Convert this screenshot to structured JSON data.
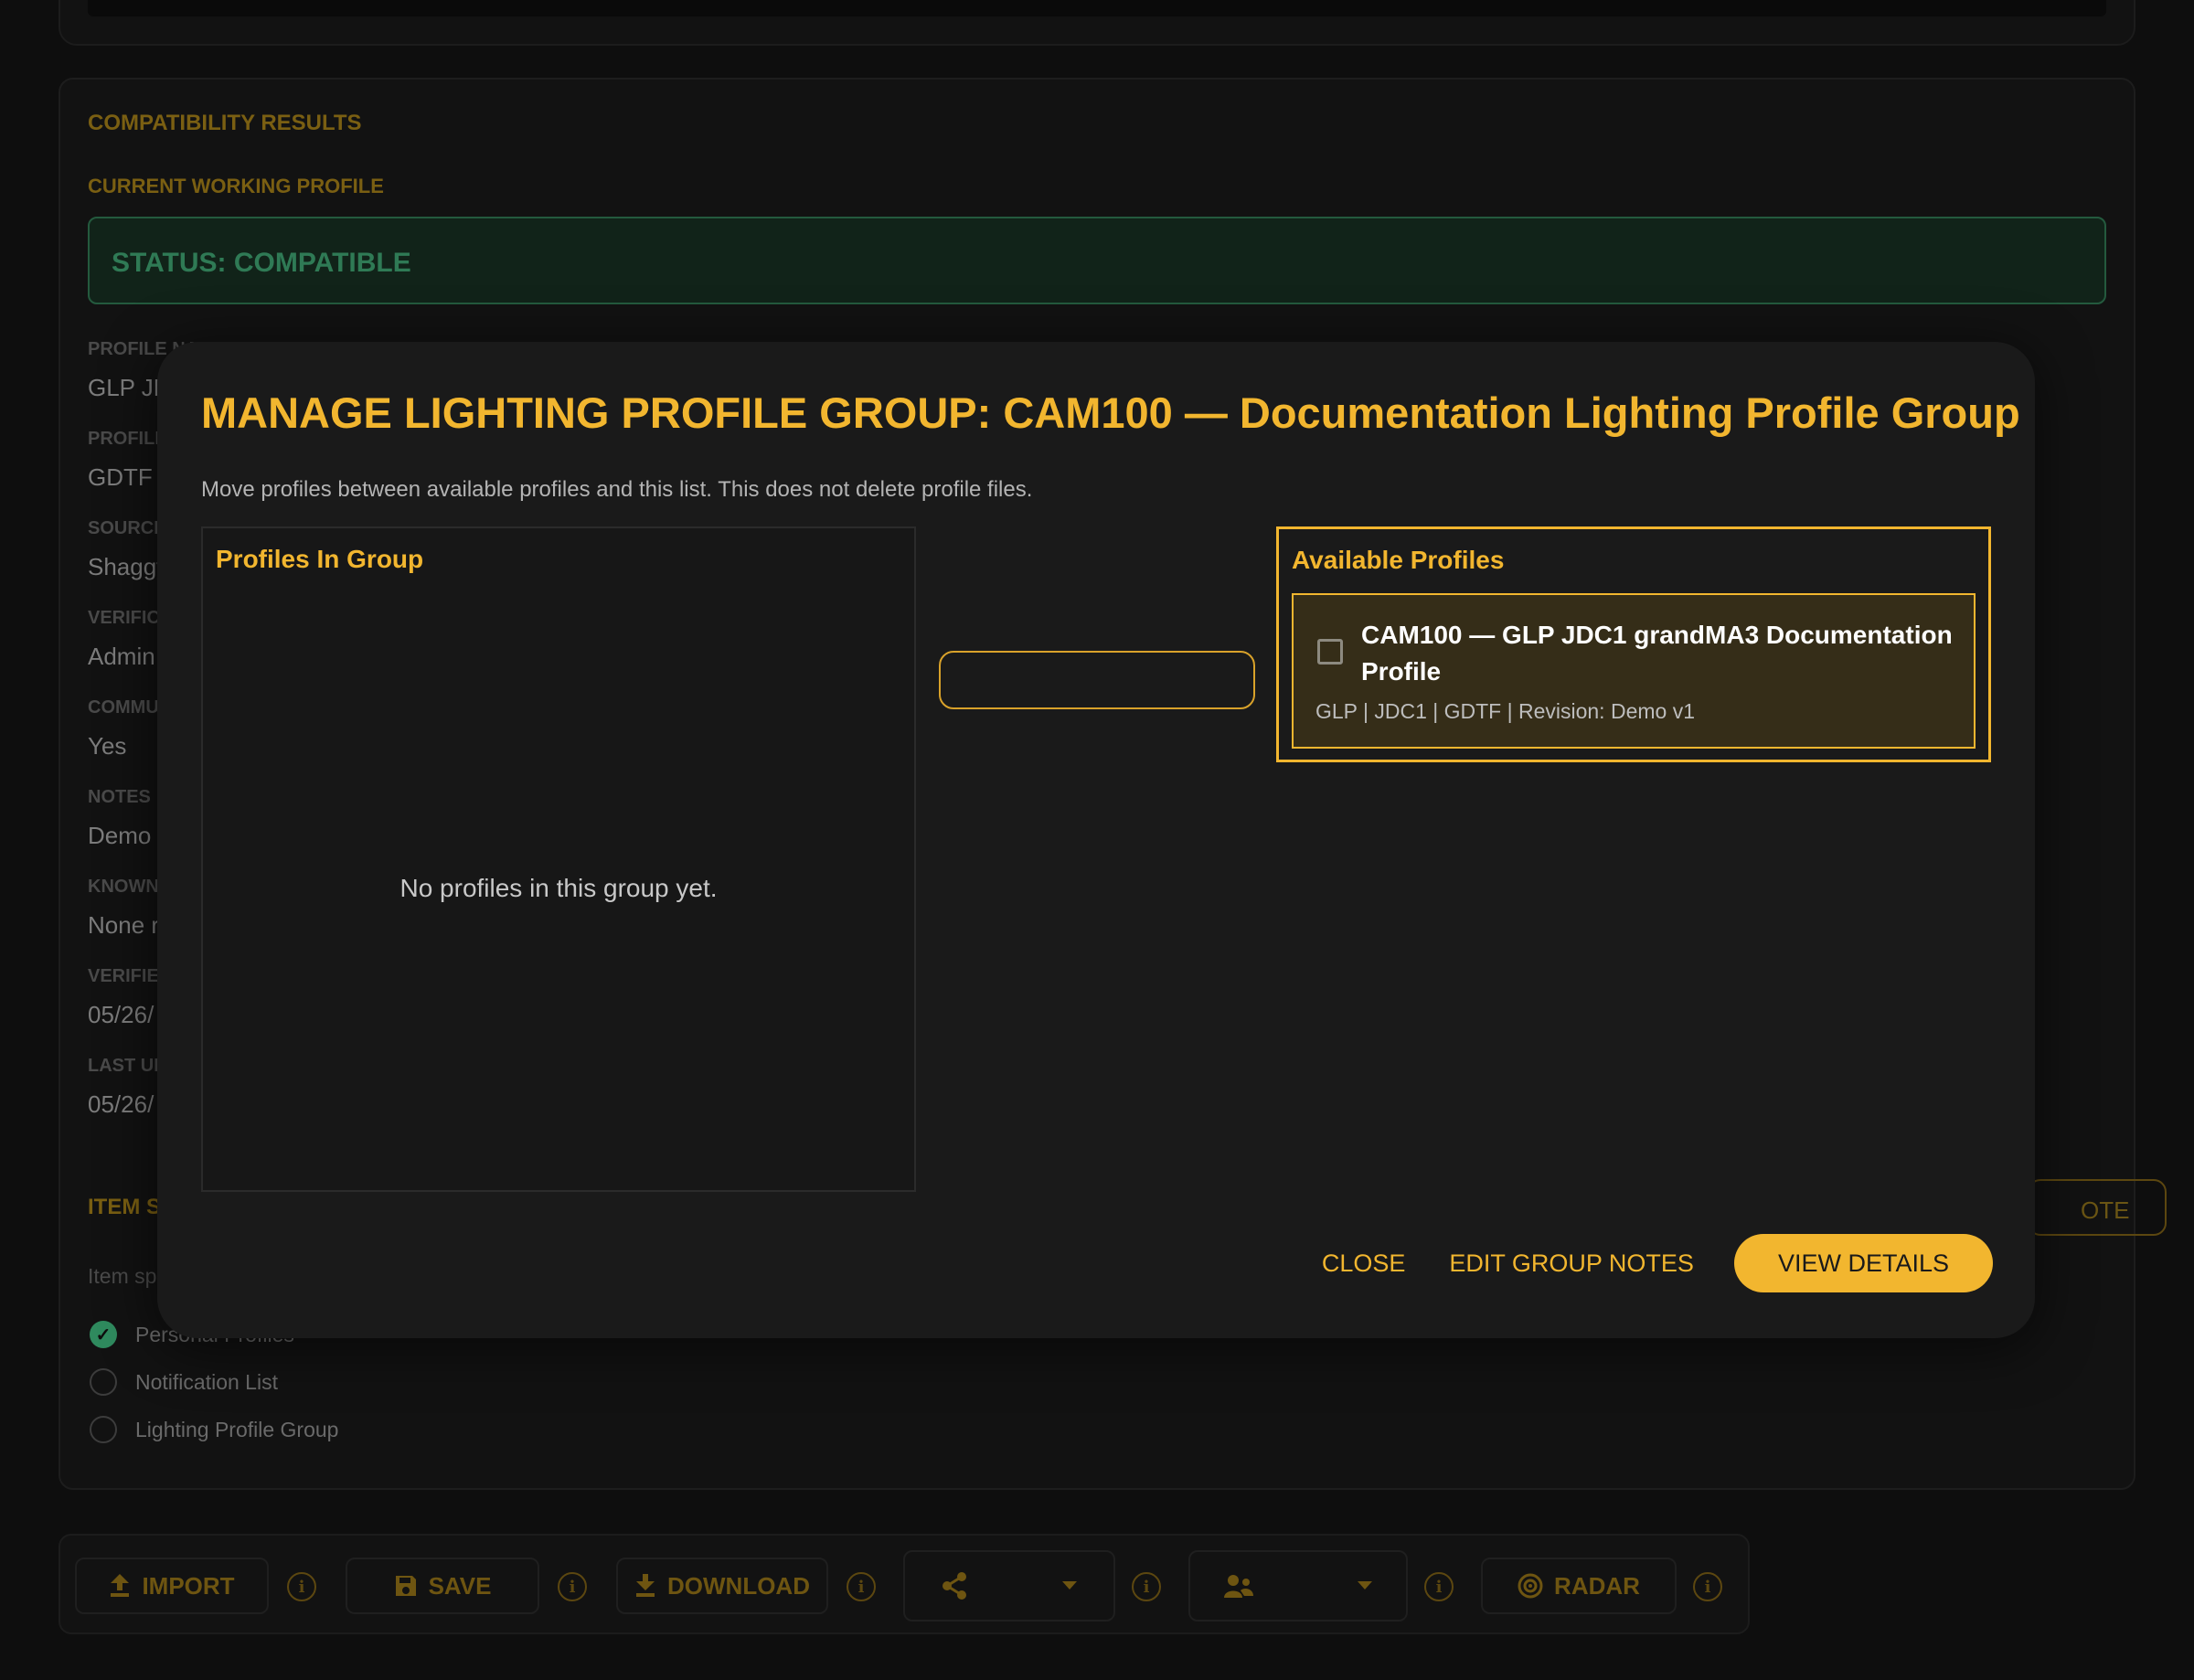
{
  "background": {
    "results_title": "COMPATIBILITY RESULTS",
    "current_profile_label": "CURRENT WORKING PROFILE",
    "status_text": "STATUS: COMPATIBLE",
    "fields": [
      {
        "label": "PROFILE NAME",
        "value": "GLP JD"
      },
      {
        "label": "PROFILE",
        "value": "GDTF"
      },
      {
        "label": "SOURCE",
        "value": "Shaggy"
      },
      {
        "label": "VERIFIC",
        "value": "Admin"
      },
      {
        "label": "COMMU",
        "value": "Yes"
      },
      {
        "label": "NOTES",
        "value": "Demo"
      },
      {
        "label": "KNOWN",
        "value": "None r"
      },
      {
        "label": "VERIFIE",
        "value": "05/26/"
      },
      {
        "label": "LAST UI",
        "value": "05/26/"
      }
    ],
    "item_section_title": "ITEM S",
    "item_section_hint": "Item sp",
    "radio_options": [
      {
        "label": "Personal Profiles",
        "checked": true
      },
      {
        "label": "Notification List",
        "checked": false
      },
      {
        "label": "Lighting Profile Group",
        "checked": false
      }
    ],
    "note_button_label": "OTE"
  },
  "toolbar": {
    "import_label": "IMPORT",
    "save_label": "SAVE",
    "download_label": "DOWNLOAD",
    "radar_label": "RADAR"
  },
  "modal": {
    "title": "MANAGE LIGHTING PROFILE GROUP: CAM100 — Documentation Lighting Profile Group",
    "description": "Move profiles between available profiles and this list. This does not delete profile files.",
    "in_group_title": "Profiles In Group",
    "empty_message": "No profiles in this group yet.",
    "available_title": "Available Profiles",
    "available_profiles": [
      {
        "name": "CAM100 — GLP JDC1 grandMA3 Documentation Profile",
        "meta": "GLP | JDC1 | GDTF | Revision: Demo v1",
        "checked": false
      }
    ],
    "actions": {
      "close_label": "CLOSE",
      "edit_notes_label": "EDIT GROUP NOTES",
      "view_details_label": "VIEW DETAILS"
    }
  },
  "colors": {
    "accent": "#f2b62f",
    "status_green": "#2f7a55",
    "modal_bg": "#1a1a1a",
    "page_bg": "#0e0e0e"
  }
}
